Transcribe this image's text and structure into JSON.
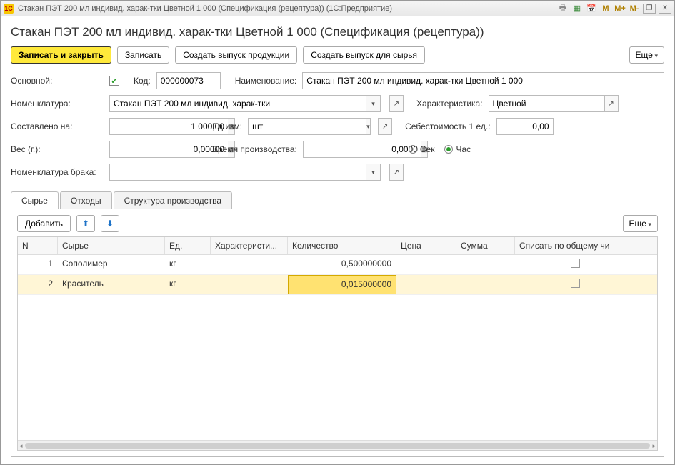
{
  "window": {
    "title": "Стакан ПЭТ 200 мл индивид. харак-тки Цветной 1 000 (Спецификация (рецептура))  (1С:Предприятие)",
    "logo_text": "1С"
  },
  "page_title": "Стакан ПЭТ 200 мл индивид. харак-тки Цветной 1 000 (Спецификация (рецептура))",
  "toolbar": {
    "save_close": "Записать и закрыть",
    "save": "Записать",
    "create_output": "Создать выпуск продукции",
    "create_raw_output": "Создать выпуск для сырья",
    "more": "Еще"
  },
  "form": {
    "main_label": "Основной:",
    "main_checked": true,
    "code_label": "Код:",
    "code_value": "000000073",
    "name_label": "Наименование:",
    "name_value": "Стакан ПЭТ 200 мл индивид. харак-тки Цветной 1 000",
    "nomen_label": "Номенклатура:",
    "nomen_value": "Стакан ПЭТ 200 мл индивид. харак-тки",
    "char_label": "Характеристика:",
    "char_value": "Цветной",
    "qty_label": "Составлено на:",
    "qty_value": "1 000,00",
    "unit_label": "Ед изм:",
    "unit_value": "шт",
    "cost_label": "Себестоимость 1 ед.:",
    "cost_value": "0,00",
    "weight_label": "Вес (г.):",
    "weight_value": "0,00000",
    "prodtime_label": "Время производства:",
    "prodtime_value": "0,0000",
    "time_sec": "Сек",
    "time_hour": "Час",
    "time_unit_selected": "hour",
    "scrap_label": "Номенклатура брака:",
    "scrap_value": ""
  },
  "tabs": {
    "raw": "Сырье",
    "waste": "Отходы",
    "structure": "Структура производства",
    "active": "raw"
  },
  "panel": {
    "add": "Добавить",
    "more": "Еще"
  },
  "columns": {
    "n": "N",
    "raw": "Сырье",
    "unit": "Ед.",
    "char": "Характеристи...",
    "qty": "Количество",
    "price": "Цена",
    "sum": "Сумма",
    "writeoff": "Списать по общему чи"
  },
  "rows": [
    {
      "n": "1",
      "raw": "Сополимер",
      "unit": "кг",
      "char": "",
      "qty": "0,500000000",
      "price": "",
      "sum": "",
      "writeoff": false,
      "selected": false
    },
    {
      "n": "2",
      "raw": "Краситель",
      "unit": "кг",
      "char": "",
      "qty": "0,015000000",
      "price": "",
      "sum": "",
      "writeoff": false,
      "selected": true
    }
  ]
}
